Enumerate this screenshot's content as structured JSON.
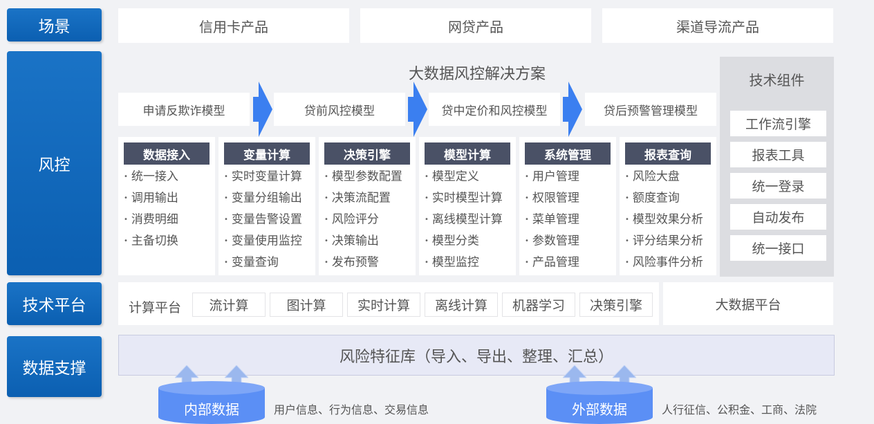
{
  "sidebar": {
    "scene": "场景",
    "risk": "风控",
    "tech_platform": "技术平台",
    "data_support": "数据支撑"
  },
  "scenes": [
    "信用卡产品",
    "网贷产品",
    "渠道导流产品"
  ],
  "risk_title": "大数据风控解决方案",
  "models": [
    "申请反欺诈模型",
    "贷前风控模型",
    "贷中定价和风控模型",
    "贷后预警管理模型"
  ],
  "modules": [
    {
      "title": "数据接入",
      "items": [
        "统一接入",
        "调用输出",
        "消费明细",
        "主备切换"
      ]
    },
    {
      "title": "变量计算",
      "items": [
        "实时变量计算",
        "变量分组输出",
        "变量告警设置",
        "变量使用监控",
        "变量查询"
      ]
    },
    {
      "title": "决策引擎",
      "items": [
        "模型参数配置",
        "决策流配置",
        "风险评分",
        "决策输出",
        "发布预警"
      ]
    },
    {
      "title": "模型计算",
      "items": [
        "模型定义",
        "实时模型计算",
        "离线模型计算",
        "模型分类",
        "模型监控"
      ]
    },
    {
      "title": "系统管理",
      "items": [
        "用户管理",
        "权限管理",
        "菜单管理",
        "参数管理",
        "产品管理"
      ]
    },
    {
      "title": "报表查询",
      "items": [
        "风险大盘",
        "额度查询",
        "模型效果分析",
        "评分结果分析",
        "风险事件分析"
      ]
    }
  ],
  "tech_components": {
    "title": "技术组件",
    "items": [
      "工作流引擎",
      "报表工具",
      "统一登录",
      "自动发布",
      "统一接口"
    ]
  },
  "platform": {
    "label": "计算平台",
    "items": [
      "流计算",
      "图计算",
      "实时计算",
      "离线计算",
      "机器学习",
      "决策引擎"
    ],
    "big_data": "大数据平台"
  },
  "data_support": {
    "feature_lib": "风险特征库（导入、导出、整理、汇总）",
    "internal": {
      "label": "内部数据",
      "desc": "用户信息、行为信息、交易信息"
    },
    "external": {
      "label": "外部数据",
      "desc": "人行征信、公积金、工商、法院"
    }
  },
  "colors": {
    "sidebar_blue": "#0b5fb1",
    "module_header": "#4a5166",
    "arrow_blue": "#3b7ff0",
    "cylinder_blue": "#5b8ff5"
  }
}
